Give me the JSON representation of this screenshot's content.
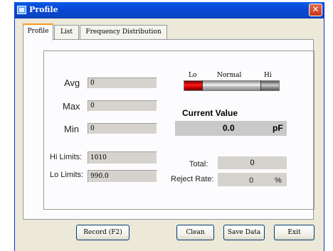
{
  "window": {
    "title": "Profile",
    "close_symbol": "✕"
  },
  "tabs": [
    {
      "label": "Profile",
      "active": true
    },
    {
      "label": "List",
      "active": false
    },
    {
      "label": "Frequency Distribution",
      "active": false
    }
  ],
  "stats": {
    "avg_label": "Avg",
    "avg_value": "0",
    "max_label": "Max",
    "max_value": "0",
    "min_label": "Min",
    "min_value": "0"
  },
  "limits": {
    "hi_label": "Hi Limits:",
    "hi_value": "1010",
    "lo_label": "Lo Limits:",
    "lo_value": "990.0"
  },
  "gauge": {
    "lo_label": "Lo",
    "normal_label": "Normal",
    "hi_label": "Hi"
  },
  "current": {
    "heading": "Current Value",
    "value": "0.0",
    "unit": "pF"
  },
  "totals": {
    "total_label": "Total:",
    "total_value": "0",
    "reject_label": "Reject Rate:",
    "reject_value": "0",
    "reject_unit": "%"
  },
  "buttons": {
    "record": "Record (F2)",
    "clean": "Clean",
    "save": "Save Data",
    "exit": "Exit"
  },
  "colors": {
    "titlebar": "#0a46d6",
    "window_face": "#ece9d8",
    "field_bg": "#d6d3ce",
    "gauge_lo": "#ff1a1a",
    "active_tab_accent": "#ff9a1a"
  }
}
